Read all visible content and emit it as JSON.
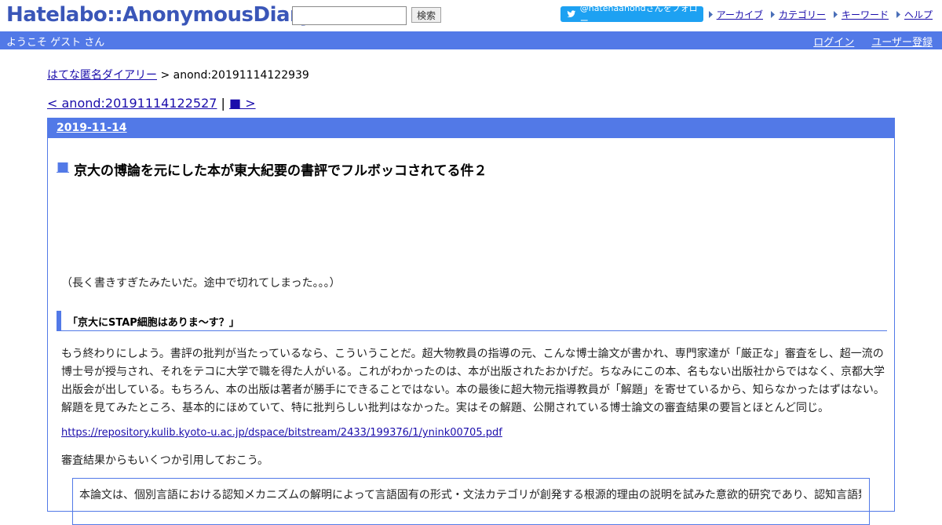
{
  "header": {
    "logo": "Hatelabo::AnonymousDiary",
    "search": {
      "value": "",
      "placeholder": "",
      "button_label": "検索"
    },
    "twitter_follow": "@hatenaanondさんをフォロー",
    "nav_links": [
      "アーカイブ",
      "カテゴリー",
      "キーワード",
      "ヘルプ"
    ]
  },
  "welcome_bar": {
    "greeting": "ようこそ ゲスト さん",
    "links": [
      "ログイン",
      "ユーザー登録"
    ]
  },
  "breadcrumb": {
    "home": "はてな匿名ダイアリー",
    "separator": " > ",
    "current": "anond:20191114122939"
  },
  "pager": {
    "prev": "< anond:20191114122527",
    "separator": " | ",
    "next": "■ >"
  },
  "day": {
    "date": "2019-11-14",
    "entry": {
      "marker": "■",
      "title": "京大の博論を元にした本が東大紀要の書評でフルボッコされてる件２",
      "note": "（長く書きすぎたみたいだ。途中で切れてしまった。。。）",
      "section_heading": "「京大にSTAP細胞はありま～す？」",
      "paragraph_lines": [
        "もう終わりにしよう。書評の批判が当たっているなら、こういうことだ。超大物教員の指導の元、こんな博士論文が書かれ、専門家達が「厳正な」審査をし、超一流の",
        "博士号が授与され、それをテコに大学で職を得た人がいる。これがわかったのは、本が出版されたおかげだ。ちなみにこの本、名もない出版社からではなく、京都大学",
        "出版会が出している。もちろん、本の出版は著者が勝手にできることではない。本の最後に超大物元指導教員が「解題」を寄せているから、知らなかったはずはない。",
        "解題を見てみたところ、基本的にほめていて、特に批判らしい批判はなかった。実はその解題、公開されている博士論文の審査結果の要旨とほとんど同じ。"
      ],
      "pdf_link": "https://repository.kulib.kyoto-u.ac.jp/dspace/bitstream/2433/199376/1/ynink00705.pdf",
      "quote_intro": "審査結果からもいくつか引用しておこう。",
      "blockquote": "本論文は、個別言語における認知メカニズムの解明によって言語固有の形式・文法カテゴリが創発する根源的理由の説明を試みた意欲的研究であり、認知言語類型論とい"
    }
  },
  "colors": {
    "brand_blue": "#5279e7",
    "logo_blue": "#3a56b8",
    "twitter_blue": "#1da1f2"
  },
  "icons": [
    "twitter-bird-icon",
    "arrow-right-icon"
  ]
}
